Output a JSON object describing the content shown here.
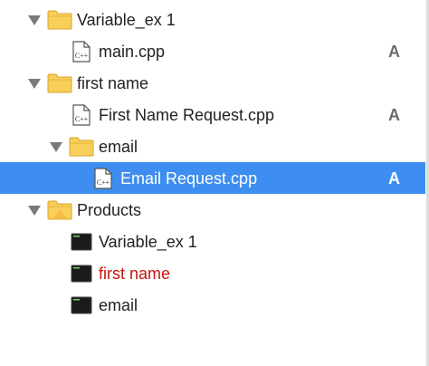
{
  "navigator": {
    "items": [
      {
        "label": "Variable_ex 1",
        "type": "folder"
      },
      {
        "label": "main.cpp",
        "type": "cpp",
        "badge": "A"
      },
      {
        "label": "first name",
        "type": "folder"
      },
      {
        "label": "First Name Request.cpp",
        "type": "cpp",
        "badge": "A"
      },
      {
        "label": "email",
        "type": "folder"
      },
      {
        "label": "Email Request.cpp",
        "type": "cpp",
        "badge": "A",
        "selected": true
      },
      {
        "label": "Products",
        "type": "products-folder"
      },
      {
        "label": "Variable_ex 1",
        "type": "executable"
      },
      {
        "label": "first name",
        "type": "executable",
        "status": "missing"
      },
      {
        "label": "email",
        "type": "executable"
      }
    ],
    "file_icon_text": "C++"
  },
  "colors": {
    "selection": "#3d8ef0",
    "folder": "#f6c443",
    "missing_text": "#c4140e",
    "badge": "#6b6b6b"
  }
}
